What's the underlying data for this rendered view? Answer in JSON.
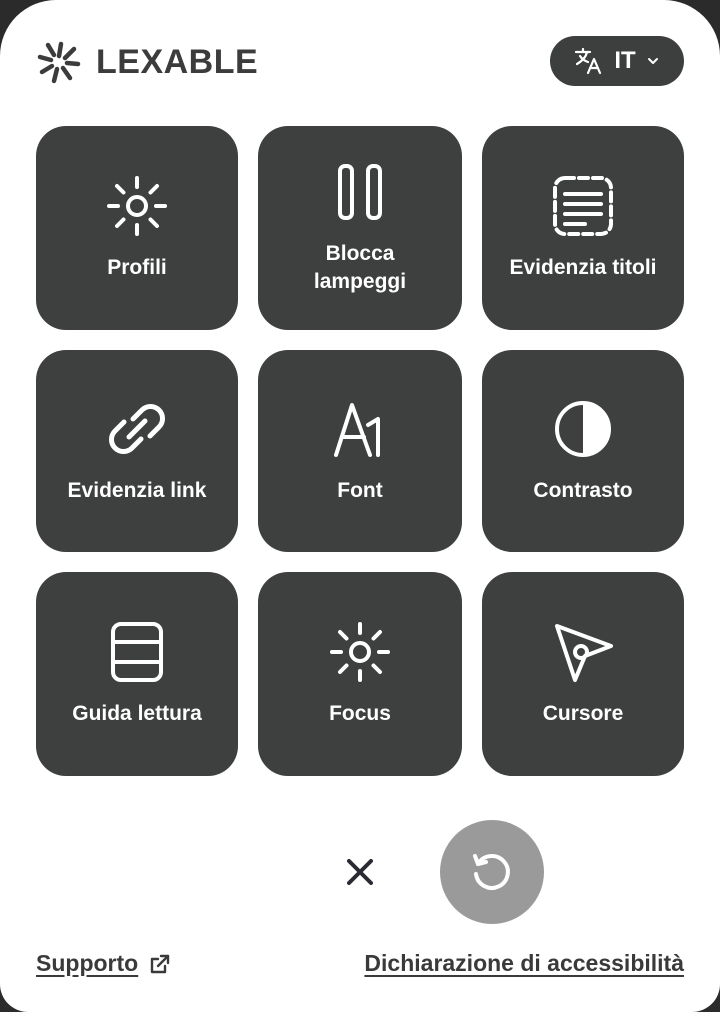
{
  "header": {
    "logo_text": "LEXABLE",
    "language": {
      "code": "IT"
    }
  },
  "tiles": [
    {
      "label": "Profili",
      "icon": "sun-icon"
    },
    {
      "label": "Blocca lampeggi",
      "icon": "pause-icon"
    },
    {
      "label": "Evidenzia titoli",
      "icon": "highlight-titles-icon"
    },
    {
      "label": "Evidenzia link",
      "icon": "link-icon"
    },
    {
      "label": "Font",
      "icon": "font-icon"
    },
    {
      "label": "Contrasto",
      "icon": "contrast-icon"
    },
    {
      "label": "Guida lettura",
      "icon": "reading-guide-icon"
    },
    {
      "label": "Focus",
      "icon": "focus-icon"
    },
    {
      "label": "Cursore",
      "icon": "cursor-icon"
    }
  ],
  "footer": {
    "support_label": "Supporto",
    "accessibility_label": "Dichiarazione di accessibilità"
  },
  "colors": {
    "tile_bg": "#3e3f3f",
    "reset_bg": "#9a9a9a",
    "text_dark": "#3a3a3a"
  }
}
